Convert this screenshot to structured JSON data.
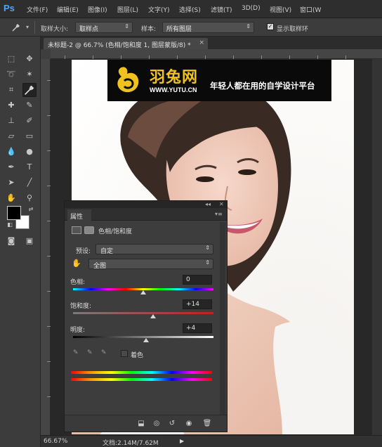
{
  "app": {
    "logo": "Ps",
    "menu": [
      "文件(F)",
      "编辑(E)",
      "图像(I)",
      "图层(L)",
      "文字(Y)",
      "选择(S)",
      "滤镜(T)",
      "3D(D)",
      "视图(V)",
      "窗口(W"
    ]
  },
  "options": {
    "tool_icon": "eyedropper-icon",
    "sample_size_label": "取样大小:",
    "sample_size_value": "取样点",
    "sample_label": "样本:",
    "sample_value": "所有图层",
    "show_ring_label": "显示取样环",
    "show_ring_checked": true
  },
  "document": {
    "tab_title": "未标题-2 @ 66.7% (色相/饱和度 1, 图层蒙版/8) *",
    "close_glyph": "×"
  },
  "watermark": {
    "brand": "羽兔网",
    "url": "WWW.YUTU.CN",
    "tagline": "年轻人都在用的自学设计平台",
    "brand_color": "#f0c21f"
  },
  "properties_panel": {
    "tab_label": "属性",
    "collapse_glyph": "◂◂",
    "menu_glyph": "▾≡",
    "close_glyph": "✕",
    "adjustment_title": "色相/饱和度",
    "preset_label": "预设:",
    "preset_value": "自定",
    "channel_value": "全图",
    "hue": {
      "label": "色相:",
      "value": "0",
      "level": 0.5
    },
    "saturation": {
      "label": "饱和度:",
      "value": "+14",
      "level": 0.57
    },
    "lightness": {
      "label": "明度:",
      "value": "+4",
      "level": 0.52
    },
    "colorize_label": "着色",
    "colorize_checked": false
  },
  "status": {
    "zoom": "66.67%",
    "doc_info": "文档:2.14M/7.62M",
    "arrow": "▶"
  }
}
